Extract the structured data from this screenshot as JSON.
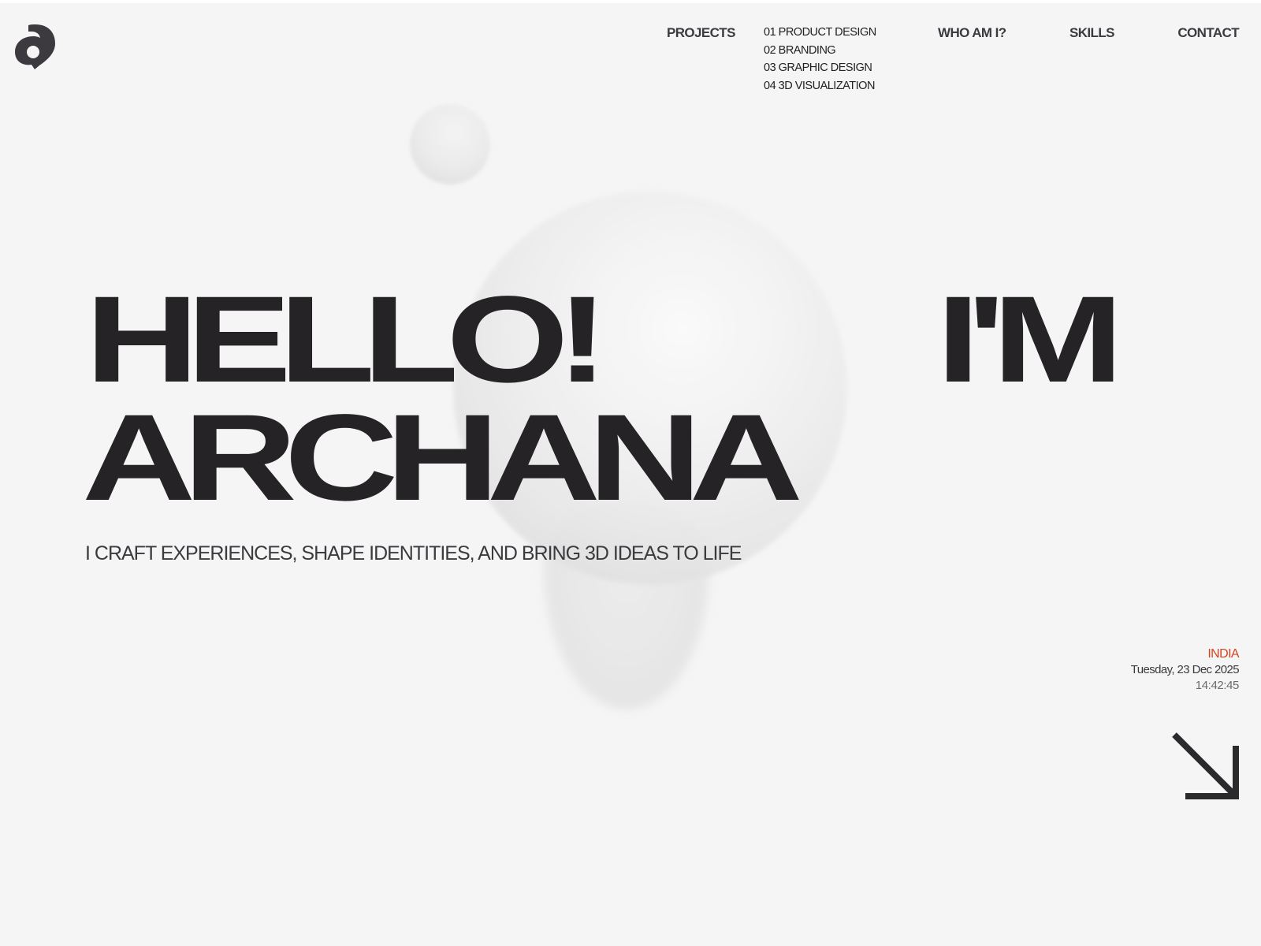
{
  "logo": {
    "icon": "a-monogram-logo-icon",
    "color": "#3c3a3e"
  },
  "nav": {
    "projects_label": "PROJECTS",
    "projects": [
      {
        "label": "01 PRODUCT DESIGN"
      },
      {
        "label": "02 BRANDING"
      },
      {
        "label": "03 GRAPHIC DESIGN"
      },
      {
        "label": "04 3D VISUALIZATION"
      }
    ],
    "who_label": "WHO AM I?",
    "skills_label": "SKILLS",
    "contact_label": "CONTACT"
  },
  "hero": {
    "line1_left": "HELLO!",
    "line1_right": "I'M",
    "line2": "ARCHANA",
    "tagline": "I CRAFT EXPERIENCES, SHAPE IDENTITIES, AND BRING 3D IDEAS TO LIFE"
  },
  "info": {
    "country": "INDIA",
    "date": "Tuesday, 23 Dec 2025",
    "time": "14:42:45"
  },
  "scroll_arrow": {
    "icon": "arrow-down-right-icon"
  },
  "colors": {
    "background": "#f5f5f5",
    "text": "#252325",
    "accent": "#d4451e"
  }
}
